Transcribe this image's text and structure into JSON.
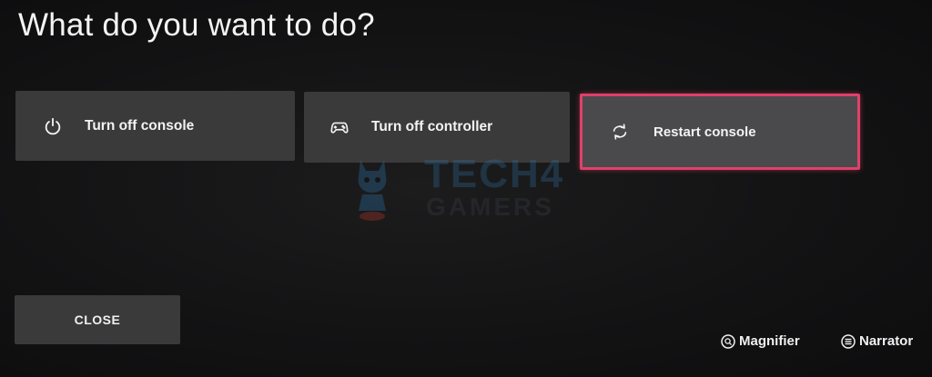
{
  "title": "What do you want to do?",
  "options": [
    {
      "label": "Turn off console",
      "icon": "power-icon",
      "selected": false
    },
    {
      "label": "Turn off controller",
      "icon": "controller-icon",
      "selected": false
    },
    {
      "label": "Restart console",
      "icon": "restart-icon",
      "selected": true
    }
  ],
  "close_label": "CLOSE",
  "footer": {
    "magnifier_label": "Magnifier",
    "narrator_label": "Narrator"
  },
  "watermark": {
    "line1": "TECH4",
    "line2": "GAMERS"
  },
  "colors": {
    "background": "#131314",
    "tile": "#3a3a3b",
    "tile_selected": "#4a4a4c",
    "focus_border": "#e0406a",
    "text": "#f2f2f2"
  }
}
